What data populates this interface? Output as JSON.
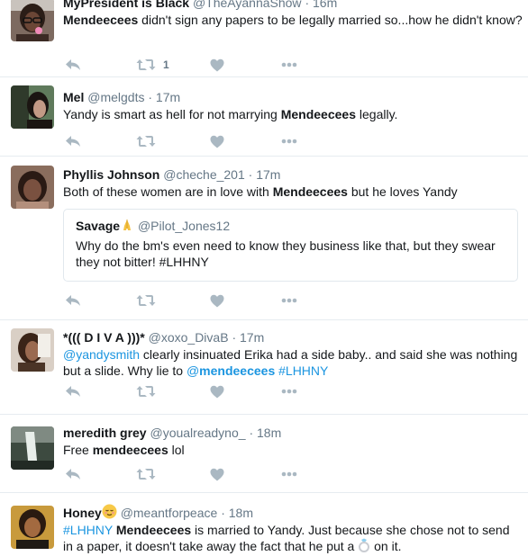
{
  "tweets": [
    {
      "fullname": "MyPresident is Black",
      "username": "@TheAyannaShow",
      "sep": "·",
      "time": "16m",
      "text_before": "",
      "keyword": "Mendeecees",
      "text_after": " didn't sign any papers to be legally married so...how he didn't know?",
      "retweet_count": "1",
      "avatar": "woman-glasses-avatar"
    },
    {
      "fullname": "Mel",
      "username": "@melgdts",
      "sep": "·",
      "time": "17m",
      "text_before": "Yandy is smart as hell for not marrying ",
      "keyword": "Mendeecees",
      "text_after": " legally.",
      "avatar": "woman-profile-avatar"
    },
    {
      "fullname": "Phyllis Johnson",
      "username": "@cheche_201",
      "sep": "·",
      "time": "17m",
      "text_before": "Both of these women are in love with ",
      "keyword": "Mendeecees",
      "text_after": " but he loves Yandy",
      "avatar": "woman-portrait-avatar",
      "quote": {
        "fullname": "Savage",
        "emoji": "praying-hands-emoji",
        "username": "@Pilot_Jones12",
        "text": "Why do the bm's even need to know they business like that, but they swear they not bitter! #LHHNY"
      }
    },
    {
      "fullname": "*((( D I V A )))*",
      "username": "@xoxo_DivaB",
      "sep": "·",
      "time": "17m",
      "mention_start": "@yandysmith",
      "text_middle": " clearly insinuated Erika had a side baby.. and said she was nothing but a slide. Why lie to ",
      "mention_end_prefix": "@",
      "mention_end_keyword": "mendeecees",
      "hashtag": " #LHHNY",
      "avatar": "woman-selfie-avatar"
    },
    {
      "fullname": "meredith grey",
      "username": "@youalreadyno_",
      "sep": "·",
      "time": "18m",
      "text_before": "Free ",
      "keyword": "mendeecees",
      "text_after": " lol",
      "avatar": "waterfall-avatar"
    },
    {
      "fullname": "Honey",
      "emoji": "relieved-face-emoji",
      "username": "@meantforpeace",
      "sep": "·",
      "time": "18m",
      "hashtag": "#LHHNY",
      "keyword": "Mendeecees",
      "text_after": " is married to Yandy. Just because she chose not to send in a paper, it doesn't take away the fact that he put a ",
      "ring_emoji": "ring-emoji",
      "text_end": " on it.",
      "avatar": "woman-hair-avatar"
    }
  ],
  "colors": {
    "link": "#1b95e0",
    "muted": "#657786",
    "icon": "#aab8c2",
    "border": "#e6ecf0"
  },
  "icons": {
    "reply": "reply-icon",
    "retweet": "retweet-icon",
    "like": "heart-icon",
    "more": "more-dots-icon"
  }
}
